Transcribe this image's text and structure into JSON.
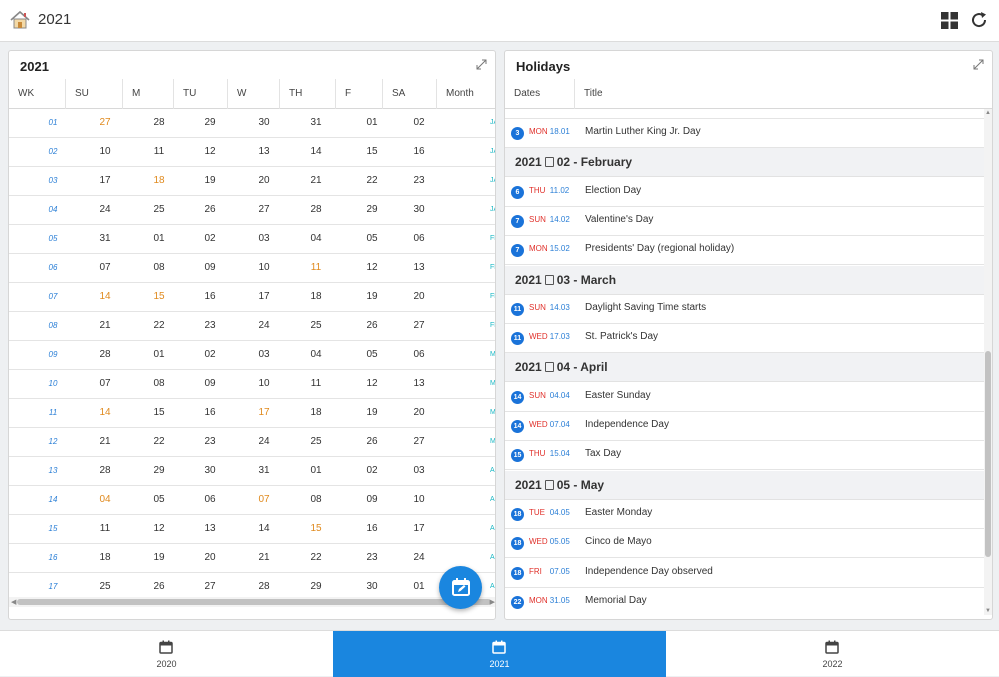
{
  "header": {
    "title": "2021",
    "home_icon": "home-icon",
    "grid_icon": "grid-icon",
    "refresh_icon": "refresh-icon"
  },
  "calendar": {
    "title": "2021",
    "columns": [
      "WK",
      "SU",
      "M",
      "TU",
      "W",
      "TH",
      "F",
      "SA",
      "Month"
    ],
    "rows": [
      {
        "wk": "01",
        "d": [
          "27",
          "28",
          "29",
          "30",
          "31",
          "01",
          "02"
        ],
        "m": "JA",
        "hl": [
          0
        ]
      },
      {
        "wk": "02",
        "d": [
          "10",
          "11",
          "12",
          "13",
          "14",
          "15",
          "16"
        ],
        "m": "JA",
        "hl": []
      },
      {
        "wk": "03",
        "d": [
          "17",
          "18",
          "19",
          "20",
          "21",
          "22",
          "23"
        ],
        "m": "JA",
        "hl": [
          1
        ]
      },
      {
        "wk": "04",
        "d": [
          "24",
          "25",
          "26",
          "27",
          "28",
          "29",
          "30"
        ],
        "m": "JA",
        "hl": []
      },
      {
        "wk": "05",
        "d": [
          "31",
          "01",
          "02",
          "03",
          "04",
          "05",
          "06"
        ],
        "m": "FE",
        "hl": []
      },
      {
        "wk": "06",
        "d": [
          "07",
          "08",
          "09",
          "10",
          "11",
          "12",
          "13"
        ],
        "m": "FE",
        "hl": [
          4
        ]
      },
      {
        "wk": "07",
        "d": [
          "14",
          "15",
          "16",
          "17",
          "18",
          "19",
          "20"
        ],
        "m": "FE",
        "hl": [
          0,
          1
        ]
      },
      {
        "wk": "08",
        "d": [
          "21",
          "22",
          "23",
          "24",
          "25",
          "26",
          "27"
        ],
        "m": "FE",
        "hl": []
      },
      {
        "wk": "09",
        "d": [
          "28",
          "01",
          "02",
          "03",
          "04",
          "05",
          "06"
        ],
        "m": "MA",
        "hl": []
      },
      {
        "wk": "10",
        "d": [
          "07",
          "08",
          "09",
          "10",
          "11",
          "12",
          "13"
        ],
        "m": "MA",
        "hl": []
      },
      {
        "wk": "11",
        "d": [
          "14",
          "15",
          "16",
          "17",
          "18",
          "19",
          "20"
        ],
        "m": "MA",
        "hl": [
          0,
          3
        ]
      },
      {
        "wk": "12",
        "d": [
          "21",
          "22",
          "23",
          "24",
          "25",
          "26",
          "27"
        ],
        "m": "MA",
        "hl": []
      },
      {
        "wk": "13",
        "d": [
          "28",
          "29",
          "30",
          "31",
          "01",
          "02",
          "03"
        ],
        "m": "AP",
        "hl": []
      },
      {
        "wk": "14",
        "d": [
          "04",
          "05",
          "06",
          "07",
          "08",
          "09",
          "10"
        ],
        "m": "AP",
        "hl": [
          0,
          3
        ]
      },
      {
        "wk": "15",
        "d": [
          "11",
          "12",
          "13",
          "14",
          "15",
          "16",
          "17"
        ],
        "m": "AP",
        "hl": [
          4
        ]
      },
      {
        "wk": "16",
        "d": [
          "18",
          "19",
          "20",
          "21",
          "22",
          "23",
          "24"
        ],
        "m": "AP",
        "hl": []
      },
      {
        "wk": "17",
        "d": [
          "25",
          "26",
          "27",
          "28",
          "29",
          "30",
          "01"
        ],
        "m": "AP",
        "hl": []
      }
    ]
  },
  "holidays": {
    "title": "Holidays",
    "col_dates": "Dates",
    "col_title": "Title",
    "entries": [
      {
        "type": "item",
        "num": "3",
        "dow": "MON",
        "date": "18.01",
        "title": "Martin Luther King Jr. Day"
      },
      {
        "type": "group",
        "year": "2021",
        "label": "02 - February"
      },
      {
        "type": "item",
        "num": "6",
        "dow": "THU",
        "date": "11.02",
        "title": "Election Day"
      },
      {
        "type": "item",
        "num": "7",
        "dow": "SUN",
        "date": "14.02",
        "title": "Valentine's Day"
      },
      {
        "type": "item",
        "num": "7",
        "dow": "MON",
        "date": "15.02",
        "title": "Presidents' Day (regional holiday)"
      },
      {
        "type": "group",
        "year": "2021",
        "label": "03 - March"
      },
      {
        "type": "item",
        "num": "11",
        "dow": "SUN",
        "date": "14.03",
        "title": "Daylight Saving Time starts"
      },
      {
        "type": "item",
        "num": "11",
        "dow": "WED",
        "date": "17.03",
        "title": "St. Patrick's Day"
      },
      {
        "type": "group",
        "year": "2021",
        "label": "04 - April"
      },
      {
        "type": "item",
        "num": "14",
        "dow": "SUN",
        "date": "04.04",
        "title": "Easter Sunday"
      },
      {
        "type": "item",
        "num": "14",
        "dow": "WED",
        "date": "07.04",
        "title": "Independence Day"
      },
      {
        "type": "item",
        "num": "15",
        "dow": "THU",
        "date": "15.04",
        "title": "Tax Day"
      },
      {
        "type": "group",
        "year": "2021",
        "label": "05 - May"
      },
      {
        "type": "item",
        "num": "18",
        "dow": "TUE",
        "date": "04.05",
        "title": "Easter Monday"
      },
      {
        "type": "item",
        "num": "18",
        "dow": "WED",
        "date": "05.05",
        "title": "Cinco de Mayo"
      },
      {
        "type": "item",
        "num": "18",
        "dow": "FRI",
        "date": "07.05",
        "title": "Independence Day observed"
      },
      {
        "type": "item",
        "num": "22",
        "dow": "MON",
        "date": "31.05",
        "title": "Memorial Day"
      }
    ]
  },
  "bottom_nav": [
    {
      "label": "2020",
      "active": false
    },
    {
      "label": "2021",
      "active": true
    },
    {
      "label": "2022",
      "active": false
    }
  ],
  "colors": {
    "accent": "#1a86df",
    "weekend_red": "#e0312b",
    "holiday_orange": "#e08a1e",
    "week_blue": "#2b7fd6",
    "month_teal": "#18b7c4"
  }
}
